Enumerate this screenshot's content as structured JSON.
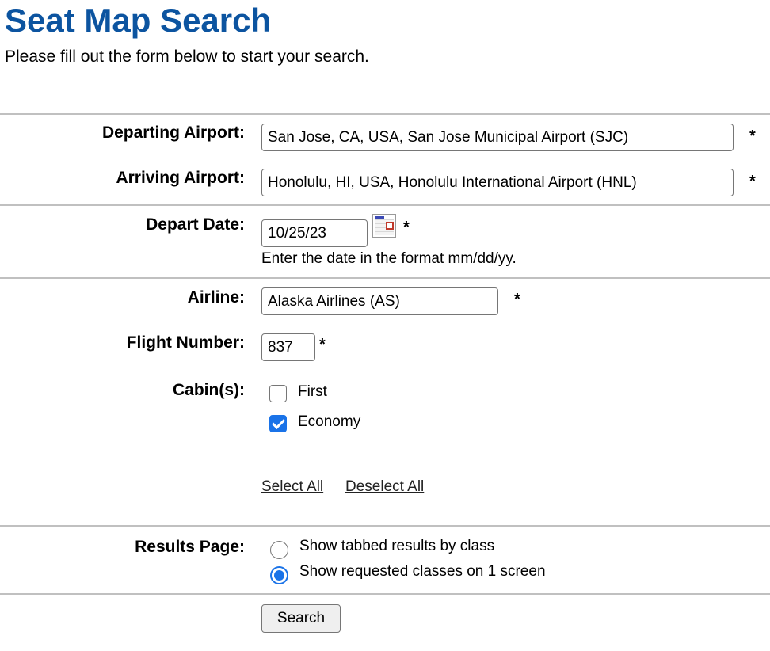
{
  "page": {
    "title": "Seat Map Search",
    "subtitle": "Please fill out the form below to start your search."
  },
  "form": {
    "departing_airport": {
      "label": "Departing Airport:",
      "value": "San Jose, CA, USA, San Jose Municipal Airport (SJC)",
      "required_mark": "*"
    },
    "arriving_airport": {
      "label": "Arriving Airport:",
      "value": "Honolulu, HI, USA, Honolulu International Airport (HNL)",
      "required_mark": "*"
    },
    "depart_date": {
      "label": "Depart Date:",
      "value": "10/25/23",
      "required_mark": "*",
      "hint": "Enter the date in the format mm/dd/yy.",
      "icon": "calendar-icon"
    },
    "airline": {
      "label": "Airline:",
      "value": "Alaska Airlines (AS)",
      "required_mark": "*"
    },
    "flight_number": {
      "label": "Flight Number:",
      "value": "837",
      "required_mark": "*"
    },
    "cabins": {
      "label": "Cabin(s):",
      "options": [
        {
          "label": "First",
          "checked": false
        },
        {
          "label": "Economy",
          "checked": true
        }
      ],
      "select_all": "Select All",
      "deselect_all": "Deselect All"
    },
    "results_page": {
      "label": "Results Page:",
      "options": [
        {
          "label": "Show tabbed results by class",
          "selected": false
        },
        {
          "label": "Show requested classes on 1 screen",
          "selected": true
        }
      ]
    },
    "search_button": "Search"
  },
  "colors": {
    "title": "#0c54a0",
    "accent": "#1a73e8",
    "divider": "#c0c0c0"
  }
}
